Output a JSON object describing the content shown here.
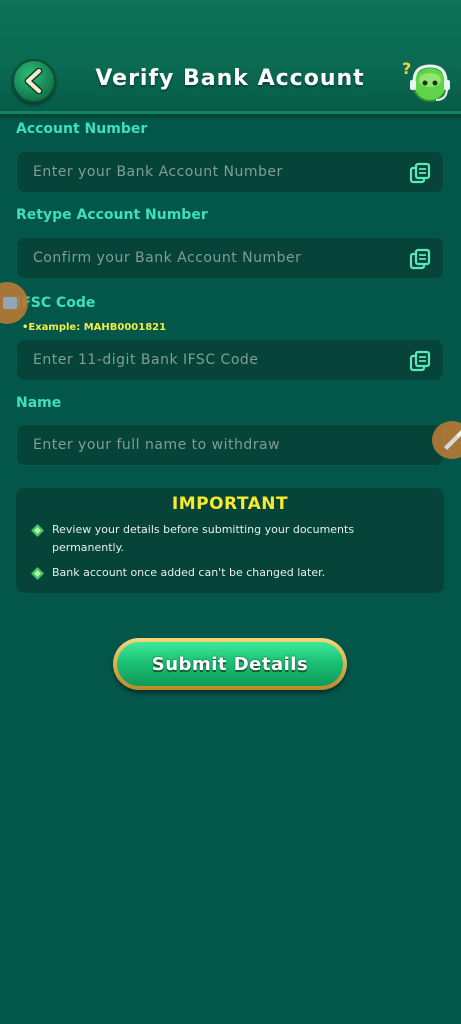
{
  "header": {
    "title": "Verify Bank Account",
    "back_icon": "chevron-left-icon",
    "help_icon": "support-agent-icon"
  },
  "form": {
    "account_number": {
      "label": "Account Number",
      "placeholder": "Enter your Bank Account Number",
      "value": ""
    },
    "retype_account_number": {
      "label": "Retype Account Number",
      "placeholder": "Confirm your Bank Account Number",
      "value": ""
    },
    "ifsc": {
      "label": "IFSC Code",
      "example": "•Example: MAHB0001821",
      "placeholder": "Enter 11-digit Bank IFSC Code",
      "value": ""
    },
    "name": {
      "label": "Name",
      "placeholder": "Enter your full name to withdraw",
      "value": ""
    },
    "paste_icon": "paste-icon"
  },
  "notice": {
    "title": "IMPORTANT",
    "items": [
      {
        "line1": "Review your details before submitting your documents",
        "line2": "permanently."
      },
      {
        "line1": "Bank account once added can't be changed later."
      }
    ]
  },
  "submit": {
    "label": "Submit Details"
  },
  "colors": {
    "background": "#03574a",
    "label": "#3fe0b8",
    "example": "#f2ee45",
    "notice_title": "#f6ea2a",
    "button": "#1cc276"
  }
}
